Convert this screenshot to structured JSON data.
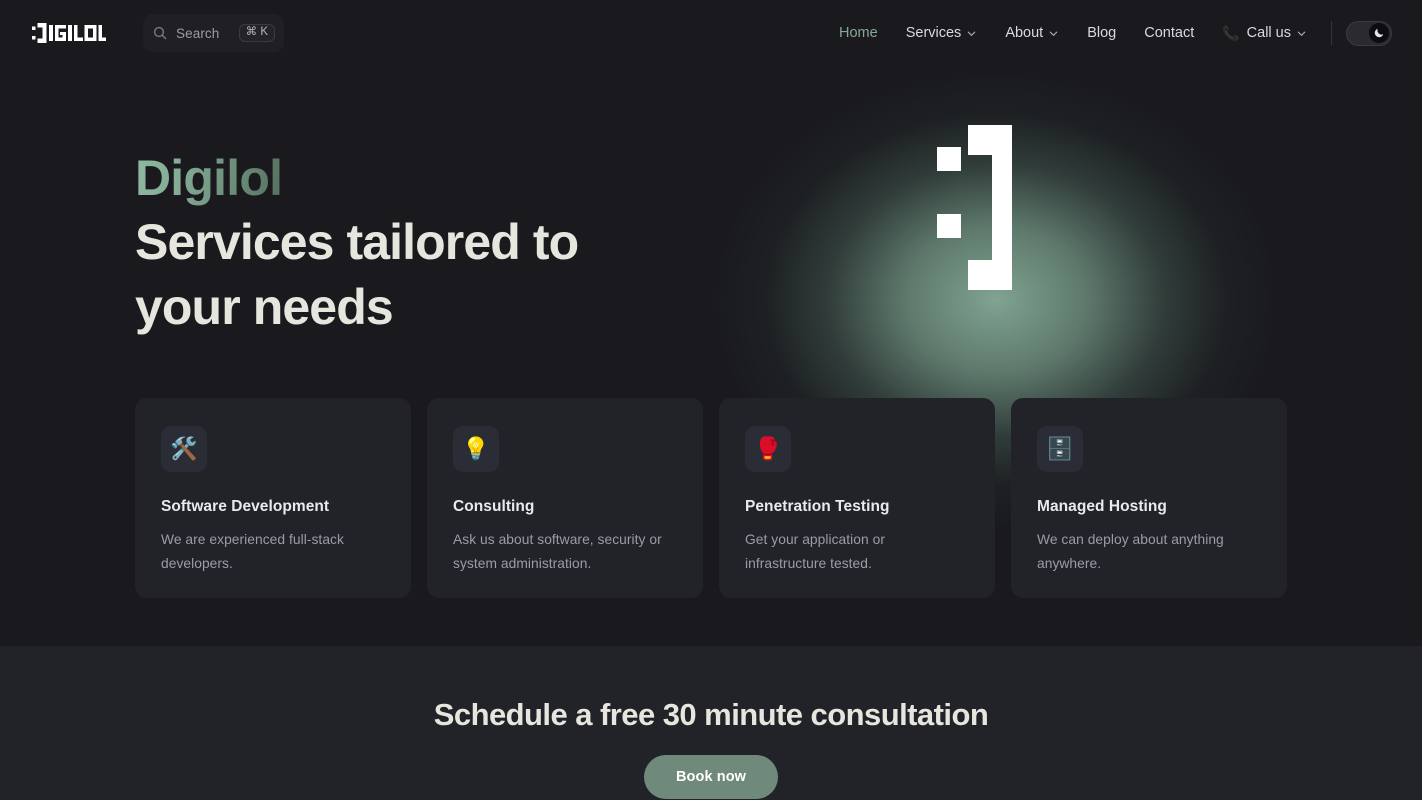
{
  "brand": {
    "logo_text": "DIGILOL",
    "logo_icon": "digilol-pixel-wordmark"
  },
  "search": {
    "icon": "search-icon",
    "placeholder": "Search",
    "shortcut": "⌘ K"
  },
  "nav": {
    "items": [
      {
        "label": "Home",
        "active": true,
        "caret": false
      },
      {
        "label": "Services",
        "active": false,
        "caret": true
      },
      {
        "label": "About",
        "active": false,
        "caret": true
      },
      {
        "label": "Blog",
        "active": false,
        "caret": false
      },
      {
        "label": "Contact",
        "active": false,
        "caret": false
      }
    ],
    "call": {
      "emoji": "📞",
      "label": "Call us",
      "caret": true
    },
    "theme_toggle": {
      "icon": "moon-icon",
      "state": "dark",
      "knob_side": "right"
    }
  },
  "hero": {
    "brand_line": "Digilol",
    "title_line_1": "Services tailored to",
    "title_line_2": "your needs",
    "graphic": "smiley-colon-bracket",
    "accent_color": "#87a896",
    "glow_color": "#86aa96"
  },
  "cards": [
    {
      "icon": "🛠️",
      "icon_name": "hammer-and-wrench-icon",
      "title": "Software Development",
      "desc": "We are experienced full-stack developers."
    },
    {
      "icon": "💡",
      "icon_name": "light-bulb-icon",
      "title": "Consulting",
      "desc": "Ask us about software, security or system administration."
    },
    {
      "icon": "🥊",
      "icon_name": "boxing-glove-icon",
      "title": "Penetration Testing",
      "desc": "Get your application or infrastructure tested."
    },
    {
      "icon": "🗄️",
      "icon_name": "file-cabinet-icon",
      "title": "Managed Hosting",
      "desc": "We can deploy about anything anywhere."
    }
  ],
  "cta": {
    "title": "Schedule a free 30 minute consultation",
    "button_label": "Book now",
    "button_color": "#6f8a7a"
  }
}
